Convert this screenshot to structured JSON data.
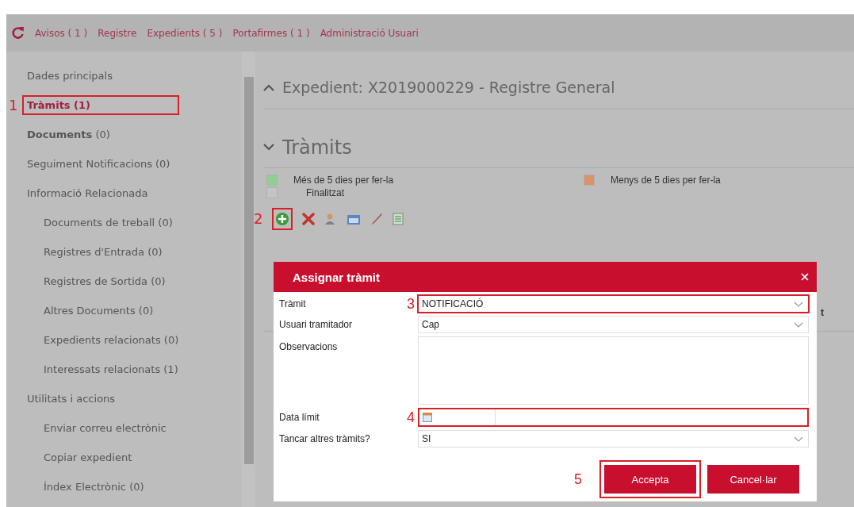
{
  "nav": {
    "items": [
      "Avisos ( 1 )",
      "Registre",
      "Expedients ( 5 )",
      "Portafirmes ( 1 )",
      "Administració Usuari"
    ]
  },
  "sidebar": {
    "items": [
      {
        "label": "Dades principals",
        "selected": false
      },
      {
        "label": "Tràmits (1)",
        "selected": true,
        "step": "1"
      },
      {
        "label": "**Documents** (0)",
        "selected": false
      },
      {
        "label": "Seguiment Notificacions (0)",
        "selected": false
      },
      {
        "label": "Informació Relacionada",
        "selected": false,
        "children": [
          {
            "label": "Documents de treball (0)",
            "selected": false
          },
          {
            "label": "Registres d'Entrada (0)",
            "selected": false
          },
          {
            "label": "Registres de Sortida (0)",
            "selected": false
          },
          {
            "label": "Altres Documents (0)",
            "selected": false
          },
          {
            "label": "Expedients relacionats (0)",
            "selected": false
          },
          {
            "label": "Interessats relacionats (1)",
            "selected": false
          }
        ]
      },
      {
        "label": "Utilitats i accions",
        "selected": false,
        "children": [
          {
            "label": "Enviar correu electrònic",
            "selected": false
          },
          {
            "label": "Copiar expedient",
            "selected": false
          },
          {
            "label": "Índex Electrònic (0)",
            "selected": false
          }
        ]
      }
    ]
  },
  "main": {
    "expedient_title": "Expedient: X2019000229 - Registre General",
    "section_title": "Tràmits",
    "legend": [
      {
        "label": "Més de 5 dies per fer-la",
        "color": "#8fcf8f"
      },
      {
        "label": "Menys de 5 dies per fer-la",
        "color": "#d8936c"
      },
      {
        "label": "Finalitzat",
        "color": "#c4c4c4"
      }
    ],
    "toolbar_step": "2",
    "column_text": "t"
  },
  "dialog": {
    "title": "Assignar tràmit",
    "fields": [
      {
        "kind": "select",
        "label": "Tràmit",
        "value": "NOTIFICACIÓ",
        "step": "3"
      },
      {
        "kind": "select",
        "label": "Usuari tramitador",
        "value": "Cap"
      },
      {
        "kind": "textarea",
        "label": "Observacions"
      },
      {
        "kind": "date",
        "label": "Data límit",
        "step": "4"
      },
      {
        "kind": "select",
        "label": "Tancar altres tràmits?",
        "value": "SI"
      }
    ],
    "buttons": [
      {
        "label": "Accepta",
        "step": "5"
      },
      {
        "label": "Cancel·lar"
      }
    ]
  }
}
